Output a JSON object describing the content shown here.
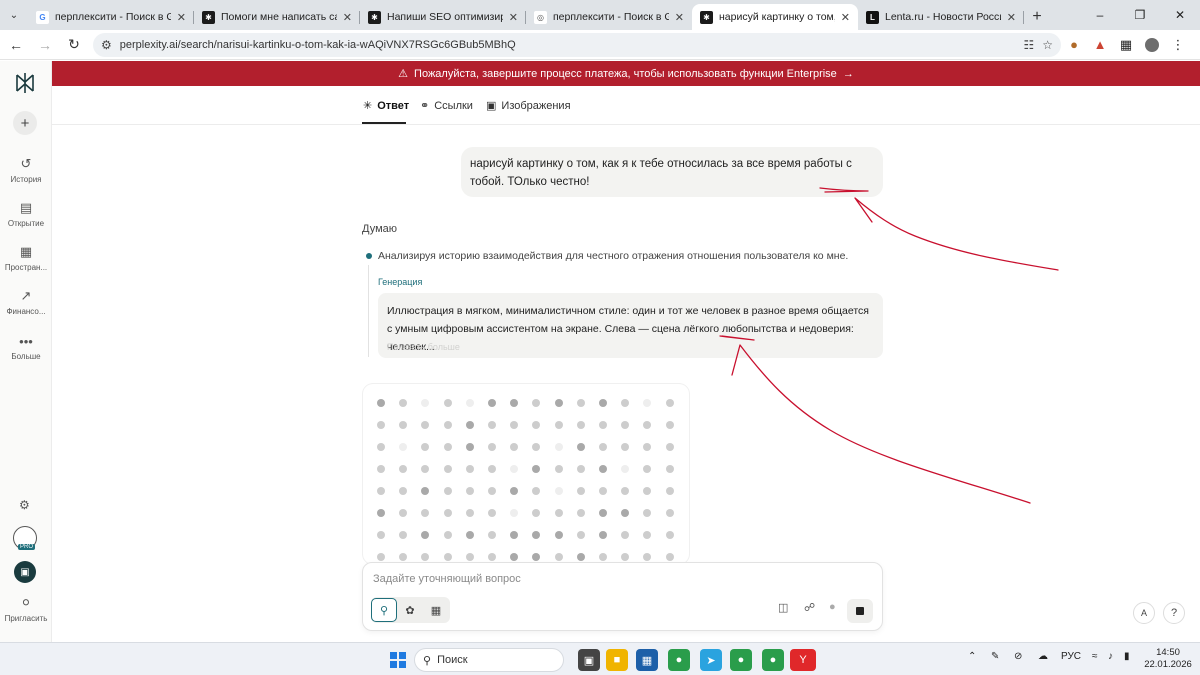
{
  "browser": {
    "tabs": [
      {
        "title": "перплексити - Поиск в Google",
        "favicon": "google-icon"
      },
      {
        "title": "Помоги мне написать самый п",
        "favicon": "perplexity-icon"
      },
      {
        "title": "Напиши SEO оптимизирован",
        "favicon": "perplexity-icon"
      },
      {
        "title": "перплексити - Поиск в Google",
        "favicon": "globe-icon"
      },
      {
        "title": "нарисуй картинку о том, как я",
        "favicon": "perplexity-icon",
        "active": true
      },
      {
        "title": "Lenta.ru - Новости России и м",
        "favicon": "lenta-icon"
      }
    ],
    "url": "perplexity.ai/search/narisui-kartinku-o-tom-kak-ia-wAQiVNX7RSGc6GBub5MBhQ"
  },
  "sidebar": {
    "items": [
      {
        "label": "История",
        "icon": "history-icon"
      },
      {
        "label": "Открытие",
        "icon": "discover-icon"
      },
      {
        "label": "Простран...",
        "icon": "spaces-icon"
      },
      {
        "label": "Финансо...",
        "icon": "finance-icon"
      },
      {
        "label": "Больше",
        "icon": "more-icon"
      }
    ],
    "invite_label": "Пригласить",
    "pro_badge": "PRO"
  },
  "banner": {
    "text": "Пожалуйста, завершите процесс платежа, чтобы использовать функции Enterprise",
    "color": "#b21f2d"
  },
  "answer_tabs": [
    {
      "label": "Ответ",
      "icon": "perplexity-icon",
      "active": true
    },
    {
      "label": "Ссылки",
      "icon": "globe-icon"
    },
    {
      "label": "Изображения",
      "icon": "image-icon"
    }
  ],
  "conversation": {
    "user_message": "нарисуй картинку о том, как я к тебе относилась за все время работы с тобой. ТОлько честно!",
    "thinking_label": "Думаю",
    "step_text": "Анализируя историю взаимодействия для честного отражения отношения пользователя ко мне.",
    "generation_label": "Генерация",
    "generation_prompt": "Иллюстрация в мягком, минималистичном стиле: один и тот же человек в разное время общается с умным цифровым ассистентом на экране. Слева — сцена лёгкого любопытства и недоверия: человек...",
    "faded_text": "Показать больше"
  },
  "image_placeholder": {
    "rows": [
      [
        2,
        1,
        0,
        1,
        0,
        2,
        2,
        1,
        2,
        1,
        2,
        1,
        0,
        1
      ],
      [
        1,
        1,
        1,
        1,
        2,
        1,
        1,
        1,
        1,
        1,
        1,
        1,
        1,
        1
      ],
      [
        1,
        0,
        1,
        1,
        2,
        1,
        1,
        1,
        0,
        2,
        1,
        1,
        1,
        1
      ],
      [
        1,
        1,
        1,
        1,
        1,
        1,
        0,
        2,
        1,
        1,
        2,
        0,
        1,
        1
      ],
      [
        1,
        1,
        2,
        1,
        1,
        1,
        2,
        1,
        0,
        1,
        1,
        1,
        1,
        1
      ],
      [
        2,
        1,
        1,
        1,
        1,
        1,
        0,
        1,
        1,
        1,
        2,
        2,
        1,
        1
      ],
      [
        1,
        1,
        2,
        1,
        2,
        1,
        2,
        2,
        2,
        1,
        2,
        1,
        1,
        1
      ],
      [
        1,
        1,
        1,
        1,
        1,
        1,
        2,
        2,
        1,
        2,
        1,
        1,
        1,
        1
      ]
    ]
  },
  "composer": {
    "placeholder": "Задайте уточняющий вопрос",
    "modes": [
      "search-icon",
      "research-icon",
      "labs-icon"
    ]
  },
  "taskbar": {
    "search_label": "Поиск",
    "language": "РУС",
    "time": "14:50",
    "date": "22.01.2026"
  }
}
